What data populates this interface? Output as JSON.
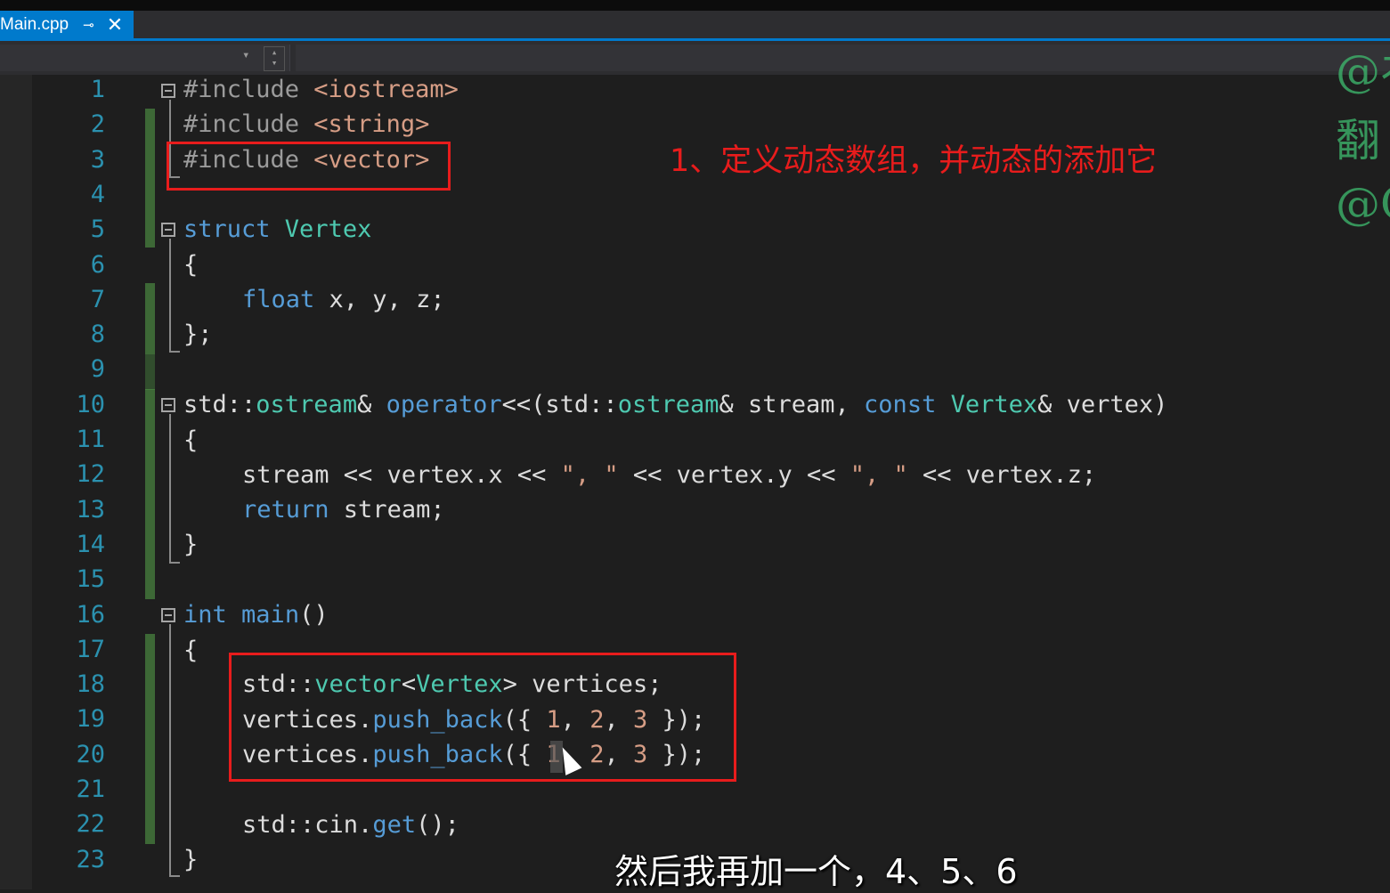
{
  "tab": {
    "name": "Main.cpp",
    "pin_icon": "pin-icon",
    "close_label": "✕"
  },
  "nav": {
    "dropdown_arrow": "▾",
    "spin": "▴▾"
  },
  "lines": [
    {
      "n": "1"
    },
    {
      "n": "2"
    },
    {
      "n": "3"
    },
    {
      "n": "4"
    },
    {
      "n": "5"
    },
    {
      "n": "6"
    },
    {
      "n": "7"
    },
    {
      "n": "8"
    },
    {
      "n": "9"
    },
    {
      "n": "10"
    },
    {
      "n": "11"
    },
    {
      "n": "12"
    },
    {
      "n": "13"
    },
    {
      "n": "14"
    },
    {
      "n": "15"
    },
    {
      "n": "16"
    },
    {
      "n": "17"
    },
    {
      "n": "18"
    },
    {
      "n": "19"
    },
    {
      "n": "20"
    },
    {
      "n": "21"
    },
    {
      "n": "22"
    },
    {
      "n": "23"
    }
  ],
  "code": {
    "l1_pp": "#include",
    "l1_rest": " <iostream>",
    "l2_pp": "#include",
    "l2_rest": " <string>",
    "l3_pp": "#include",
    "l3_rest": " <vector>",
    "l5_kw": "struct",
    "l5_ty": " Vertex",
    "l6": "{",
    "l7_kw": "float",
    "l7_rest": " x, y, z;",
    "l8": "};",
    "l10_a": "std::",
    "l10_b": "ostream",
    "l10_c": "& ",
    "l10_d": "operator",
    "l10_e": "<<(std::",
    "l10_f": "ostream",
    "l10_g": "& stream, ",
    "l10_h": "const",
    "l10_i": " ",
    "l10_j": "Vertex",
    "l10_k": "& vertex)",
    "l11": "{",
    "l12_a": "stream << vertex.x << ",
    "l12_s1": "\", \"",
    "l12_b": " << vertex.y << ",
    "l12_s2": "\", \"",
    "l12_c": " << vertex.z;",
    "l13_kw": "return",
    "l13_rest": " stream;",
    "l14": "}",
    "l16_kw": "int",
    "l16_sp": " ",
    "l16_fn": "main",
    "l16_rest": "()",
    "l17": "{",
    "l18_a": "std::",
    "l18_b": "vector",
    "l18_c": "<",
    "l18_d": "Vertex",
    "l18_e": "> vertices;",
    "l19_a": "vertices.",
    "l19_b": "push_back",
    "l19_c": "({ ",
    "l19_n1": "1",
    "l19_d": ", ",
    "l19_n2": "2",
    "l19_e": ", ",
    "l19_n3": "3",
    "l19_f": " });",
    "l20_a": "vertices.",
    "l20_b": "push_back",
    "l20_c": "({ ",
    "l20_n1": "1",
    "l20_d": ", ",
    "l20_n2": "2",
    "l20_e": ", ",
    "l20_n3": "3",
    "l20_f": " });",
    "l22_a": "std::cin.",
    "l22_b": "get",
    "l22_c": "();",
    "l23": "}"
  },
  "annotation": "1、定义动态数组，并动态的添加它",
  "subtitle": "然后我再加一个，4、5、6",
  "watermark": [
    "@衤",
    "翻",
    "@C"
  ],
  "colors": {
    "keyword": "#569cd6",
    "type": "#4ec9b0",
    "string": "#d69d85",
    "number": "#b5cea8",
    "linenum": "#2b91af",
    "annotation": "#e81c1c",
    "tab": "#007acc"
  }
}
